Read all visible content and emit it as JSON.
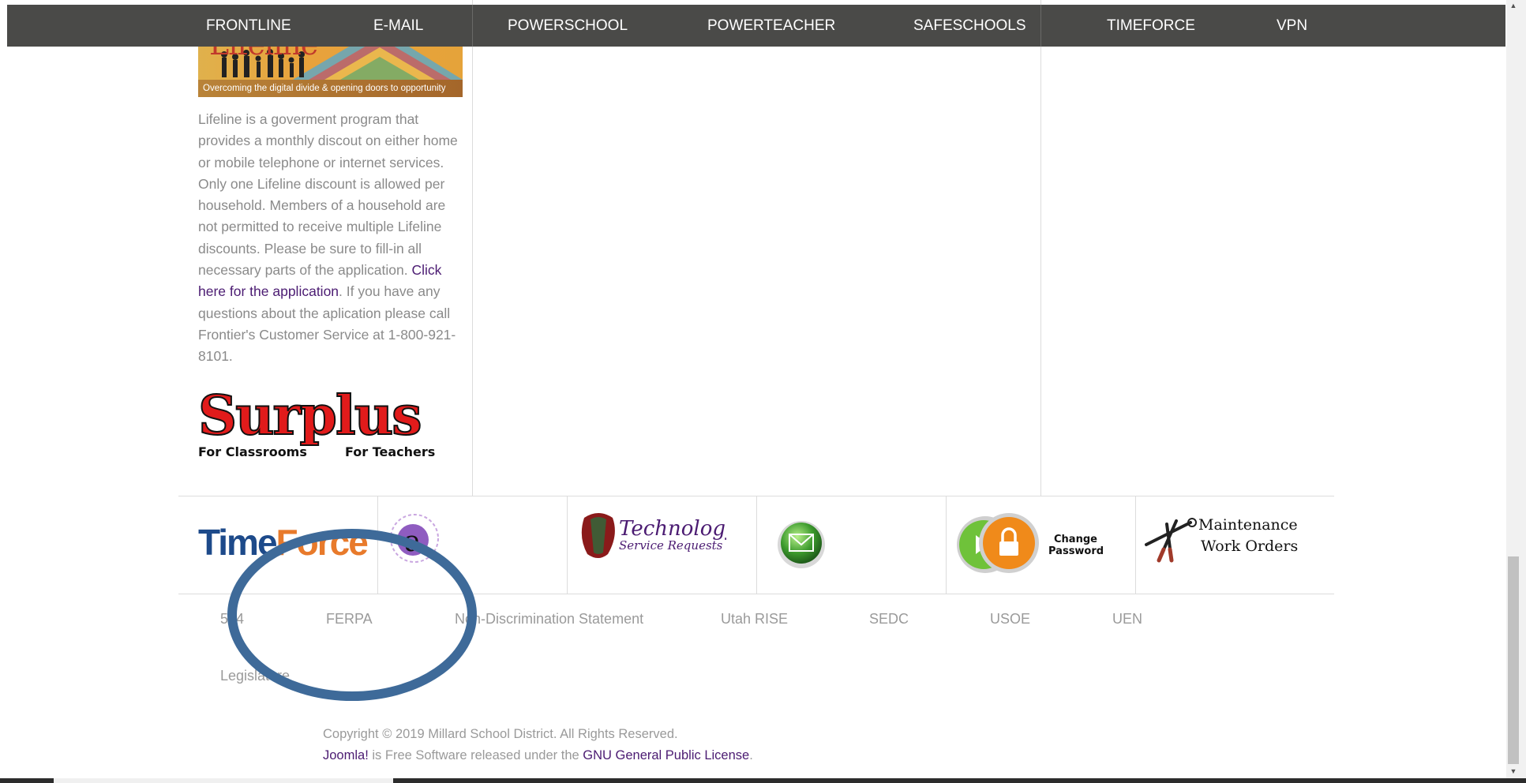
{
  "nav": {
    "items": [
      {
        "label": "FRONTLINE"
      },
      {
        "label": "E-MAIL"
      },
      {
        "label": "POWERSCHOOL"
      },
      {
        "label": "POWERTEACHER"
      },
      {
        "label": "SAFESCHOOLS"
      },
      {
        "label": "TIMEFORCE"
      },
      {
        "label": "VPN"
      }
    ]
  },
  "lifeline": {
    "banner_word": "Lifeline",
    "banner_tagline": "Overcoming the digital divide & opening doors to opportunity",
    "body": "Lifeline is a goverment program that provides a monthly discout on either home or mobile telephone or internet services. Only one Lifeline discount is allowed per household. Members of a household are not permitted to receive multiple Lifeline discounts. Please be sure to fill-in all necessary parts of the application.",
    "link_text": "Click here for the application",
    "after_link": ". If you have any questions about the aplication  please call Frontier's Customer Service at 1-800-921-8101."
  },
  "surplus": {
    "title": "Surplus",
    "left_sub": "For Classrooms",
    "right_sub": "For Teachers"
  },
  "icons": {
    "timeforce": {
      "time": "Time",
      "force": "Force"
    },
    "technology": {
      "line1": "Technology",
      "line2": "Service Requests"
    },
    "password": {
      "line1": "Change",
      "line2": "Password"
    },
    "maintenance": {
      "line1": "Maintenance",
      "line2": "Work Orders"
    }
  },
  "footer_links": [
    "504",
    "FERPA",
    "Non-Discrimination Statement",
    "Utah RISE",
    "SEDC",
    "USOE",
    "UEN",
    "Legislature"
  ],
  "copyright": {
    "line1": "Copyright © 2019 Millard School District. All Rights Reserved.",
    "joomla": "Joomla!",
    "middle": " is Free Software released under the ",
    "gnu": "GNU General Public License",
    "end": "."
  },
  "colors": {
    "nav_bg": "#4a4a48",
    "link_purple": "#4b1b72",
    "annotation_blue": "#3e6a99",
    "surplus_red": "#e11b1b"
  }
}
